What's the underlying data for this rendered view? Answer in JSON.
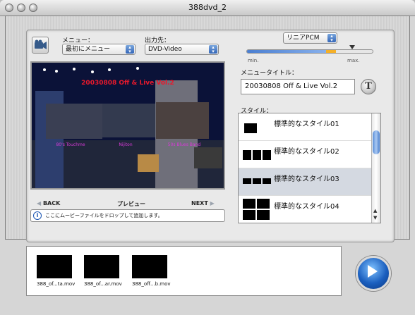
{
  "window": {
    "title": "388dvd_2"
  },
  "menu": {
    "label": "メニュー：",
    "value": "最初にメニュー"
  },
  "output": {
    "label": "出力先：",
    "value": "DVD-Video"
  },
  "audio": {
    "format": "リニアPCM",
    "min_label": "min.",
    "max_label": "max.",
    "level": 0.7
  },
  "menu_title": {
    "label": "メニュータイトル：",
    "value": "20030808 Off & Live Vol.2"
  },
  "preview": {
    "title": "20030808 Off & Live Vol.2",
    "chapters": [
      "80's Touchme",
      "Nijiton",
      "50s Blues Band"
    ]
  },
  "nav": {
    "back": "BACK",
    "preview": "プレビュー",
    "next": "NEXT"
  },
  "info": {
    "text": "ここにムービーファイルをドロップして追加します。"
  },
  "style": {
    "label": "スタイル：",
    "items": [
      "標準的なスタイル01",
      "標準的なスタイル02",
      "標準的なスタイル03",
      "標準的なスタイル04"
    ],
    "selected_index": 2
  },
  "files": [
    "388_of...ta.mov",
    "388_of...ar.mov",
    "388_off...b.mov"
  ],
  "colors": {
    "accent": "#3366b8",
    "preview_title": "#e8192c",
    "chapter_label": "#d83ad8"
  }
}
